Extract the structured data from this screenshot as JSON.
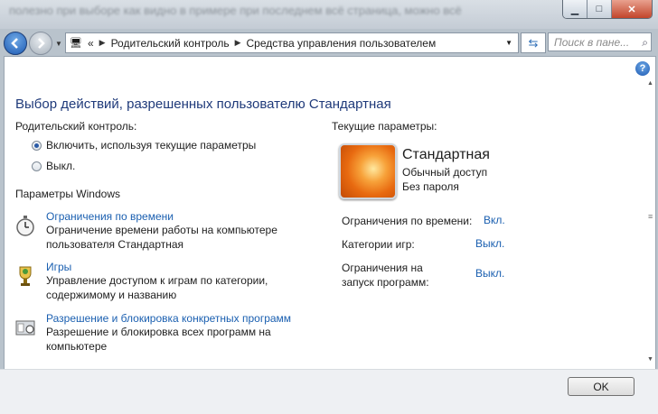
{
  "window": {
    "background_text": "полезно при выборе как видно в примере при последнем всё страница, можно всё",
    "minimize_glyph": "▁",
    "maximize_glyph": "□",
    "close_glyph": "✕"
  },
  "navigation": {
    "breadcrumb": [
      "Родительский контроль",
      "Средства управления пользователем"
    ],
    "breadcrumb_prefix": "«",
    "search_placeholder": "Поиск в пане..."
  },
  "main": {
    "title": "Выбор действий, разрешенных пользователю Стандартная",
    "parental_control_label": "Родительский контроль:",
    "options": [
      {
        "label": "Включить, используя текущие параметры",
        "selected": true
      },
      {
        "label": "Выкл.",
        "selected": false
      }
    ],
    "windows_settings_label": "Параметры Windows",
    "settings": [
      {
        "title": "Ограничения по времени",
        "description": [
          "Ограничение времени работы на компьютере",
          "пользователя Стандартная"
        ],
        "icon": "stopwatch-icon"
      },
      {
        "title": "Игры",
        "description": [
          "Управление доступом к играм по категории,",
          "содержимому и названию"
        ],
        "icon": "trophy-icon"
      },
      {
        "title": "Разрешение и блокировка конкретных программ",
        "description": [
          "Разрешение и блокировка всех программ на",
          "компьютере"
        ],
        "icon": "program-block-icon"
      }
    ]
  },
  "current": {
    "label": "Текущие параметры:",
    "user_name": "Стандартная",
    "account_type": "Обычный доступ",
    "password": "Без пароля",
    "params": [
      {
        "name": [
          "Ограничения по времени:"
        ],
        "value": "Вкл."
      },
      {
        "name": [
          "Категории игр:"
        ],
        "value": "Выкл."
      },
      {
        "name": [
          "Ограничения на",
          "запуск программ:"
        ],
        "value": "Выкл."
      }
    ]
  },
  "footer": {
    "ok_label": "OK"
  },
  "colors": {
    "link": "#1a5fb0",
    "heading": "#1f3a7a"
  }
}
